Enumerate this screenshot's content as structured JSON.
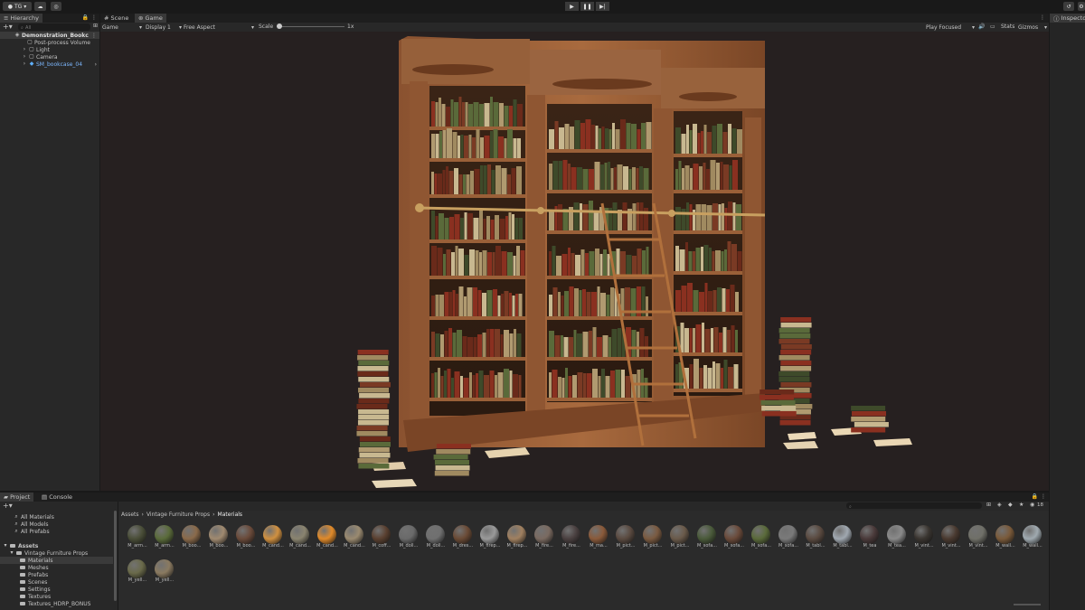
{
  "toolbar": {
    "account": "TG",
    "play_icon": "play-icon",
    "pause_icon": "pause-icon",
    "step_icon": "step-icon"
  },
  "hierarchy": {
    "tab": "Hierarchy",
    "search_placeholder": "All",
    "scene_name": "Demonstration_Bookc",
    "items": [
      "Post-process Volume",
      "Light",
      "Camera",
      "SM_bookcase_04"
    ]
  },
  "game_view": {
    "tabs": [
      "Scene",
      "Game"
    ],
    "mode": "Game",
    "display": "Display 1",
    "aspect": "Free Aspect",
    "scale_label": "Scale",
    "scale_value": "1x",
    "play_focused": "Play Focused",
    "stats": "Stats",
    "gizmos": "Gizmos"
  },
  "inspector": {
    "tab": "Inspector"
  },
  "project": {
    "tabs": [
      "Project",
      "Console"
    ],
    "favorites": [
      "All Materials",
      "All Models",
      "All Prefabs"
    ],
    "assets_root": "Assets",
    "tree": [
      "Vintage Furniture Props",
      "Materials",
      "Meshes",
      "Prefabs",
      "Scenes",
      "Settings",
      "Textures",
      "Textures_HDRP_BONUS"
    ],
    "breadcrumb": [
      "Assets",
      "Vintage Furniture Props",
      "Materials"
    ],
    "count": "18",
    "assets": [
      {
        "label": "M_arm...",
        "color": "#4a4e38"
      },
      {
        "label": "M_arm...",
        "color": "#5a6b3a"
      },
      {
        "label": "M_boo...",
        "color": "#8a6a4a"
      },
      {
        "label": "M_boo...",
        "color": "#a08a70"
      },
      {
        "label": "M_boo...",
        "color": "#6a4a3a"
      },
      {
        "label": "M_cand...",
        "color": "#d09040"
      },
      {
        "label": "M_cand...",
        "color": "#8a8470"
      },
      {
        "label": "M_cand...",
        "color": "#e08a2a"
      },
      {
        "label": "M_cand...",
        "color": "#9a8a70"
      },
      {
        "label": "M_coff...",
        "color": "#5a4030"
      },
      {
        "label": "M_doll...",
        "color": "#6a6a6a"
      },
      {
        "label": "M_doll...",
        "color": "#707070"
      },
      {
        "label": "M_dres...",
        "color": "#6a4a35"
      },
      {
        "label": "M_firep...",
        "color": "#9a9a9a"
      },
      {
        "label": "M_firep...",
        "color": "#a08060"
      },
      {
        "label": "M_fire...",
        "color": "#7a6a60"
      },
      {
        "label": "M_fire...",
        "color": "#4a4040"
      },
      {
        "label": "M_ma...",
        "color": "#8a5a3a"
      },
      {
        "label": "M_pict...",
        "color": "#5a4a40"
      },
      {
        "label": "M_pict...",
        "color": "#7a5a40"
      },
      {
        "label": "M_pict...",
        "color": "#6a5a4a"
      },
      {
        "label": "M_sofa...",
        "color": "#4a5a3a"
      },
      {
        "label": "M_sofa...",
        "color": "#6a4a3a"
      },
      {
        "label": "M_sofa...",
        "color": "#5a6a3a"
      },
      {
        "label": "M_sofa...",
        "color": "#7a7a7a"
      },
      {
        "label": "M_tabl...",
        "color": "#5a4a40"
      },
      {
        "label": "M_tabl...",
        "color": "#a0a8b0"
      },
      {
        "label": "M_tea",
        "color": "#4a3a3a"
      },
      {
        "label": "M_tea...",
        "color": "#8a8a8a"
      },
      {
        "label": "M_vint...",
        "color": "#3a3530"
      },
      {
        "label": "M_vint...",
        "color": "#4a3a30"
      },
      {
        "label": "M_vint...",
        "color": "#707068"
      },
      {
        "label": "M_wall...",
        "color": "#7a5a3a"
      },
      {
        "label": "M_wall...",
        "color": "#a0aab0"
      },
      {
        "label": "M_yell...",
        "color": "#6a6a4a"
      },
      {
        "label": "M_yell...",
        "color": "#8a7a60"
      }
    ]
  }
}
